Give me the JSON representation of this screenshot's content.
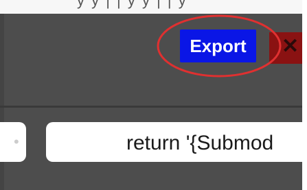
{
  "toolbar": {
    "export_label": "Export",
    "close_icon": "close-icon",
    "accent_color": "#0a16e6",
    "close_color": "#8a1212"
  },
  "annotation": {
    "ring_color": "#e03030"
  },
  "fields": {
    "code_value": "return '{Submod"
  }
}
